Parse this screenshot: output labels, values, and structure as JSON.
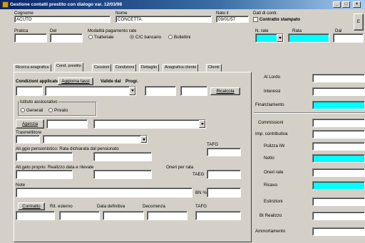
{
  "window": {
    "title": "Gestione contatti prestito con dialogo var. 12/03/98",
    "controls": [
      "_",
      "□",
      "×"
    ]
  },
  "header": {
    "cognome_label": "Cognome",
    "cognome_value": "ACUTO",
    "nome_label": "Nome",
    "nome_value": "CONCETTA",
    "nato_il_label": "Nato il",
    "nato_il_value": "09/01/57",
    "dati_contratto_label": "Dati di contr.",
    "controllo_stampato_label": "Contratto stampato",
    "side_button": "E",
    "pratica_label": "Pratica",
    "del_label": "Del",
    "modalita_label": "Modalità pagamento rate",
    "modalita_options": [
      "Tratteriale",
      "C/C bancario",
      "Bollettini"
    ],
    "n_rate_label": "N. rate",
    "rata_label": "Rata",
    "dal_label": "Dal"
  },
  "tabs": [
    "Ricerca anagrafica",
    "Cond. prestito",
    "Cessioni",
    "Condizioni",
    "Dettaglio",
    "Anagrafica cliente",
    "Clienti"
  ],
  "active_tab": 1,
  "panel": {
    "condizioni_label": "Condizioni applicate",
    "aggiorna_button": "Aggiorna tassi",
    "valide_dal_label": "Valide dal",
    "progr_label": "Progr.",
    "ricalcola_button": "Ricalcola",
    "istituto_label": "Istituto assicurativo",
    "istituto_options": [
      "Generali",
      "Privato"
    ],
    "agenzia_button": "Agenzia",
    "trasmettitore_label": "Trasmettitore",
    "alt_pensionistico_label": "All.ggio pensionistico: Rata dichiarata dal pensionato",
    "tafg_label": "TAFG",
    "alt_proprio_label": "All.gato proprio: Realizzo data e rilevate",
    "oneri_label": "Oneri per rata",
    "taeg_label": "TAEG",
    "note_label": "Note",
    "bn_label": "BN %",
    "contratto_button": "Contratto",
    "rit_esterno_label": "Rit. esterno",
    "data_definitiva_label": "Data definitiva",
    "decorrenza_label": "Decorrenza",
    "tafg2_label": "TAFG"
  },
  "right_panel": {
    "labels": [
      "Al Lordo",
      "Interessi",
      "Finanziamento",
      "Commissioni",
      "Imp. contributiva",
      "Polizza IW",
      "Netto",
      "Oneri rate",
      "Ricavo",
      "Estinzioni",
      "Bt Realizzo",
      "Ammortamento"
    ],
    "cyan_rows": [
      2,
      6,
      8
    ]
  },
  "colors": {
    "highlight": "#00ffff",
    "titlebar": "#0a246a"
  }
}
